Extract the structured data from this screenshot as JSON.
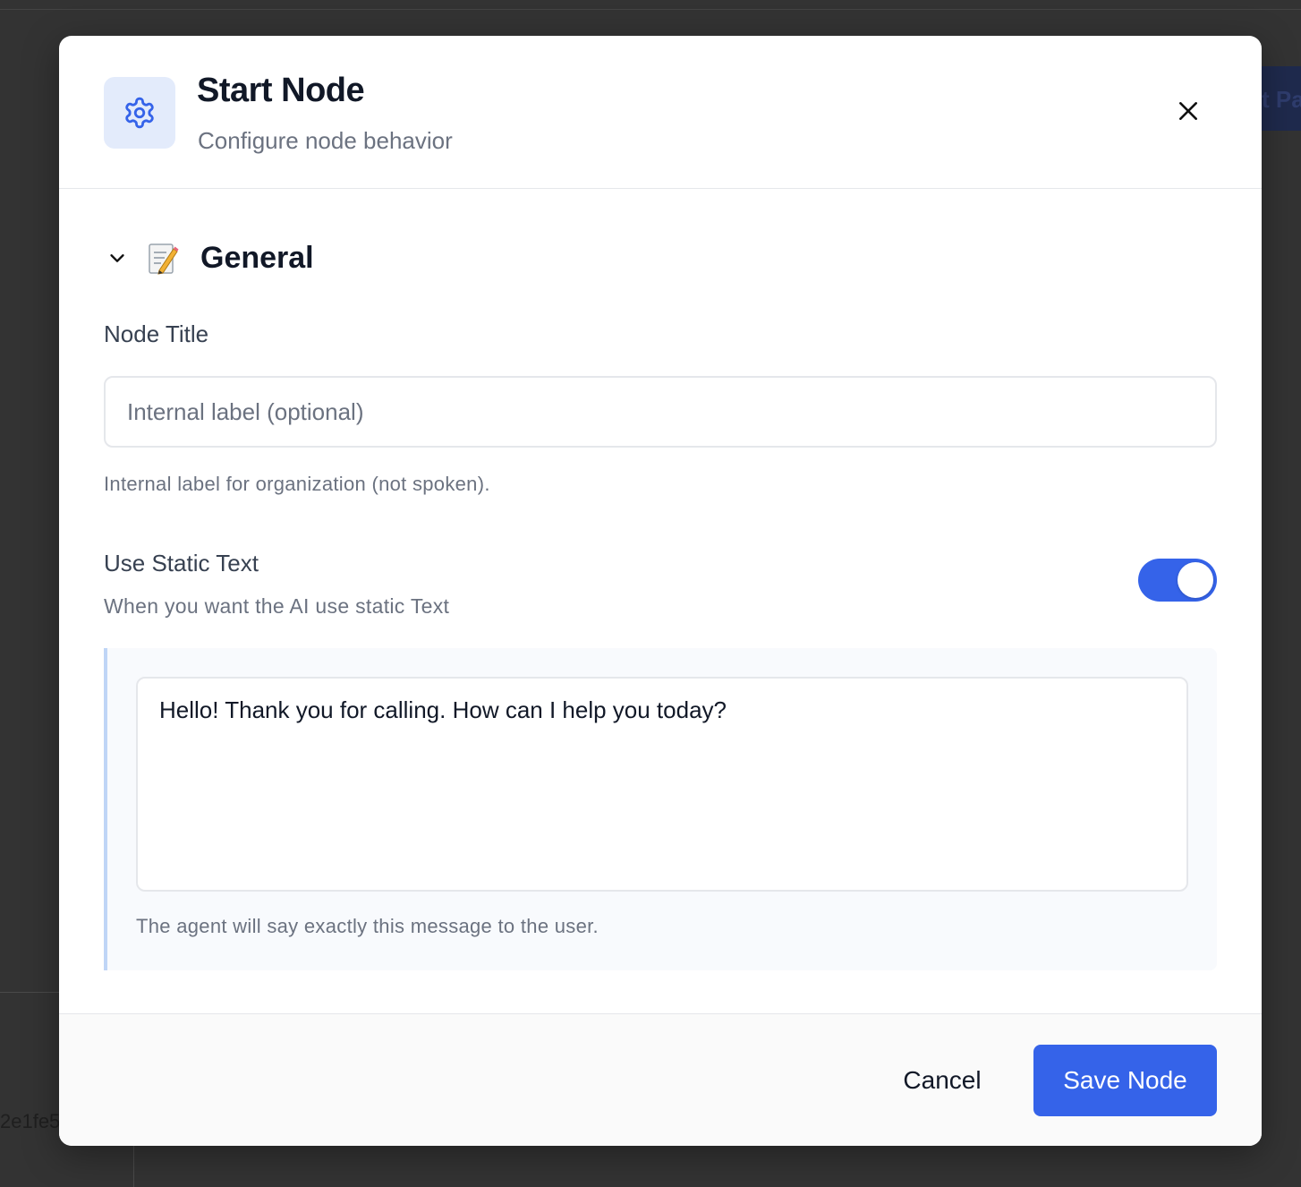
{
  "background": {
    "hash_fragment": "2e1fe5",
    "button_fragment": "t Pa"
  },
  "modal": {
    "title": "Start Node",
    "subtitle": "Configure node behavior",
    "icon": "gear-icon",
    "close_icon": "close-icon"
  },
  "section": {
    "title": "General",
    "emoji": "memo-icon",
    "expanded": true
  },
  "node_title": {
    "label": "Node Title",
    "value": "",
    "placeholder": "Internal label (optional)",
    "help": "Internal label for organization (not spoken)."
  },
  "static_text": {
    "label": "Use Static Text",
    "description": "When you want the AI use static Text",
    "enabled": true,
    "message": "Hello! Thank you for calling. How can I help you today?",
    "help": "The agent will say exactly this message to the user."
  },
  "footer": {
    "cancel_label": "Cancel",
    "save_label": "Save Node"
  },
  "colors": {
    "accent": "#3563e9",
    "overlay": "#333333",
    "icon_bg": "#e3ebfb"
  }
}
